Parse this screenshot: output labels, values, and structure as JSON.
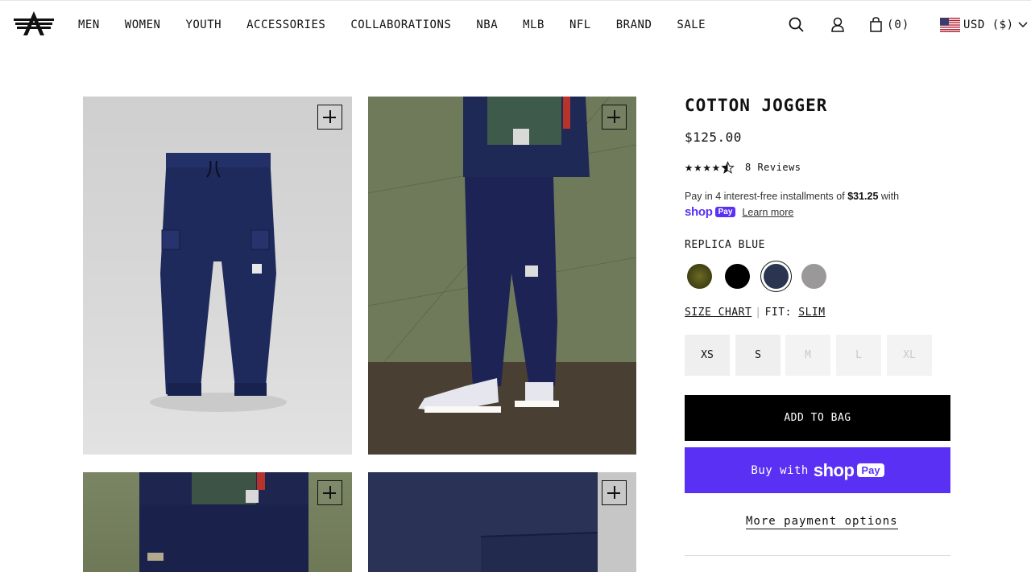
{
  "header": {
    "logo_icon": "alpha-industries-logo-icon",
    "nav": [
      "MEN",
      "WOMEN",
      "YOUTH",
      "ACCESSORIES",
      "COLLABORATIONS",
      "NBA",
      "MLB",
      "NFL",
      "BRAND",
      "SALE"
    ],
    "bag_count": "(0)",
    "currency": "USD ($)",
    "icons": [
      "search-icon",
      "account-icon",
      "bag-icon",
      "us-flag-icon",
      "chevron-down-icon"
    ]
  },
  "product": {
    "title": "COTTON JOGGER",
    "price": "$125.00",
    "rating": 4.5,
    "reviews": "8 Reviews",
    "installments_prefix": "Pay in 4 interest-free installments of ",
    "installments_amount": "$31.25",
    "installments_suffix": " with",
    "shop_word": "shop",
    "pay_badge": "Pay",
    "learn_more": "Learn more",
    "color_name": "REPLICA BLUE",
    "swatches": [
      {
        "name": "olive",
        "color": "#4a4a18"
      },
      {
        "name": "black",
        "color": "#000000"
      },
      {
        "name": "replica-blue",
        "color": "#2a3550",
        "selected": true
      },
      {
        "name": "grey",
        "color": "#9a9898"
      }
    ],
    "size_chart": "SIZE CHART",
    "fit_label": "FIT:",
    "fit_value": "SLIM",
    "sizes": [
      {
        "label": "XS",
        "available": true
      },
      {
        "label": "S",
        "available": true
      },
      {
        "label": "M",
        "available": false
      },
      {
        "label": "L",
        "available": false
      },
      {
        "label": "XL",
        "available": false
      }
    ],
    "add_to_bag": "ADD TO BAG",
    "buy_with": "Buy with",
    "more_payment": "More payment options"
  },
  "colors": {
    "shop_purple": "#5a31f4",
    "black": "#000000"
  }
}
